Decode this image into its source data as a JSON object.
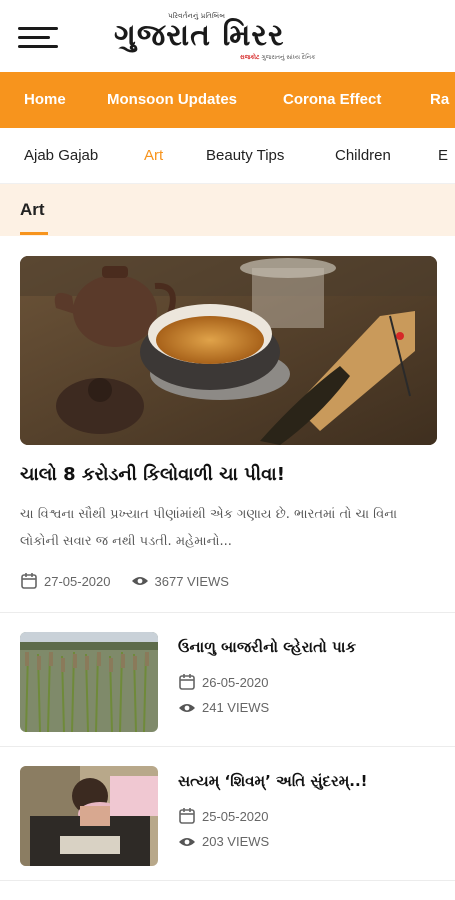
{
  "header": {
    "logo_tagline": "પરિવર્તનનું પ્રતિબિંબ",
    "logo_title": "ગુજરાત મિરર",
    "logo_sub_brand": "રાજકોટ",
    "logo_sub_text": "ગુજરાતનું સાંધ્ય દૈનિક"
  },
  "main_nav": [
    {
      "label": "Home"
    },
    {
      "label": "Monsoon Updates"
    },
    {
      "label": "Corona Effect"
    },
    {
      "label": "Ra"
    }
  ],
  "sub_nav": [
    {
      "label": "Ajab Gajab"
    },
    {
      "label": "Art"
    },
    {
      "label": "Beauty Tips"
    },
    {
      "label": "Children"
    },
    {
      "label": "E"
    }
  ],
  "section": {
    "title": "Art"
  },
  "featured": {
    "title": "ચાલો 8 કરોડની કિલોવાળી ચા પીવા!",
    "excerpt": "ચા વિશ્વના સૌથી પ્રખ્યાત પીણાંમાંથી એક ગણાય છે. ભારતમાં તો ચા વિના લોકોની સવાર જ નથી પડતી. મહેમાનો...",
    "date": "27-05-2020",
    "views": "3677 VIEWS"
  },
  "articles": [
    {
      "title": "ઉનાળુ બાજરીનો લ્હેરાતો પાક",
      "date": "26-05-2020",
      "views": "241 VIEWS"
    },
    {
      "title": "સત્યમ્ ‘શિવમ્’ અતિ સુંદરમ્..!",
      "date": "25-05-2020",
      "views": "203 VIEWS"
    }
  ],
  "colors": {
    "accent": "#f7941d",
    "section_band": "#fdf1e4",
    "text_dark": "#111111",
    "text_muted": "#666666"
  },
  "icons": {
    "menu": "hamburger-menu-icon",
    "date": "calendar-icon",
    "views": "eye-icon"
  }
}
